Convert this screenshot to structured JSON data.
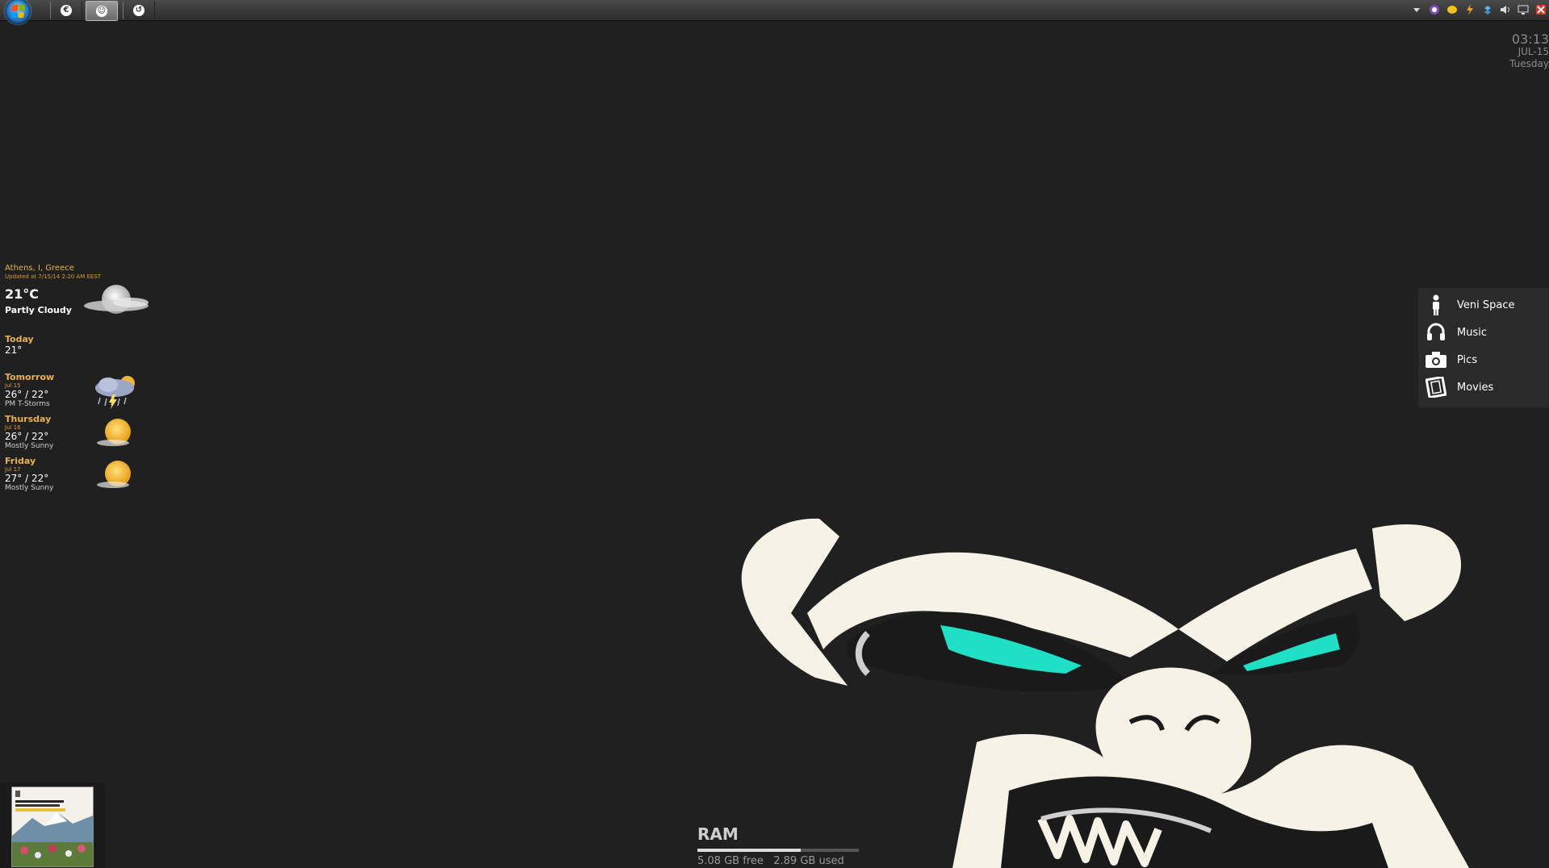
{
  "taskbar": {
    "start_label": "Start",
    "buttons": [
      {
        "id": "app-1",
        "glyph": "€",
        "active": false
      },
      {
        "id": "app-2",
        "glyph": "☺",
        "active": true
      },
      {
        "id": "app-3",
        "glyph": "↺",
        "active": false
      }
    ],
    "tray_icons": [
      "chevron-up-icon",
      "viber-icon",
      "note-icon",
      "power-icon",
      "dropbox-icon",
      "volume-icon",
      "network-icon",
      "flag-icon"
    ]
  },
  "clock": {
    "time": "03:13",
    "date": "JUL-15",
    "day": "Tuesday"
  },
  "weather": {
    "location": "Athens, I, Greece",
    "updated": "Updated at 7/15/14 2:20 AM EEST",
    "current_temp": "21°C",
    "current_condition": "Partly Cloudy",
    "today_label": "Today",
    "today_value": "21°",
    "forecast": [
      {
        "day": "Tomorrow",
        "date": "Jul 15",
        "range": "26° / 22°",
        "desc": "PM T-Storms",
        "icon": "thunderstorm-icon"
      },
      {
        "day": "Thursday",
        "date": "Jul 16",
        "range": "26° / 22°",
        "desc": "Mostly Sunny",
        "icon": "sun-icon"
      },
      {
        "day": "Friday",
        "date": "Jul 17",
        "range": "27° / 22°",
        "desc": "Mostly Sunny",
        "icon": "sun-icon"
      }
    ]
  },
  "launcher": {
    "items": [
      {
        "label": "Veni Space",
        "icon": "person-icon"
      },
      {
        "label": "Music",
        "icon": "headphones-icon"
      },
      {
        "label": "Pics",
        "icon": "camera-icon"
      },
      {
        "label": "Movies",
        "icon": "film-icon"
      }
    ]
  },
  "ram": {
    "title": "RAM",
    "free": "5.08 GB free",
    "used": "2.89 GB used",
    "used_fraction": 0.64
  },
  "colors": {
    "background": "#202020",
    "accent_gold": "#e8b34a",
    "eye_teal": "#1fe0c4",
    "ape_cream": "#f6f3e6"
  }
}
